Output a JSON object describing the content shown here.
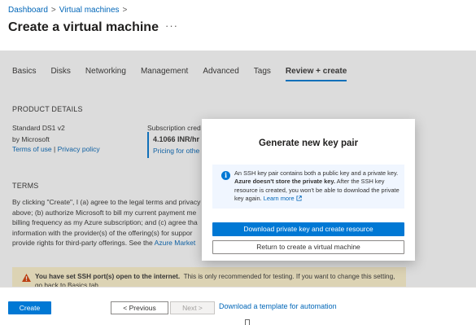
{
  "breadcrumb": {
    "items": [
      "Dashboard",
      "Virtual machines"
    ],
    "separator": ">"
  },
  "page": {
    "title": "Create a virtual machine",
    "more_label": "···"
  },
  "tabs": [
    {
      "label": "Basics",
      "active": false
    },
    {
      "label": "Disks",
      "active": false
    },
    {
      "label": "Networking",
      "active": false
    },
    {
      "label": "Management",
      "active": false
    },
    {
      "label": "Advanced",
      "active": false
    },
    {
      "label": "Tags",
      "active": false
    },
    {
      "label": "Review + create",
      "active": true
    }
  ],
  "product": {
    "heading": "PRODUCT DETAILS",
    "name": "Standard DS1 v2",
    "publisher": "by Microsoft",
    "terms_link": "Terms of use",
    "separator": "|",
    "privacy_link": "Privacy policy",
    "subscription_label": "Subscription cred",
    "price": "4.1066 INR/hr",
    "pricing_link": "Pricing for othe"
  },
  "terms": {
    "heading": "TERMS",
    "lines": [
      "By clicking \"Create\", I (a) agree to the legal terms and privacy",
      "above; (b) authorize Microsoft to bill my current payment me",
      "billing frequency as my Azure subscription; and (c) agree tha",
      "information with the provider(s) of the offering(s) for suppor",
      "provide rights for third-party offerings. See the"
    ],
    "marketplace_link": "Azure Market"
  },
  "warning": {
    "bold": "You have set SSH port(s) open to the internet.",
    "text": "This is only recommended for testing.  If you want to change this setting,",
    "line2": "go back to Basics tab."
  },
  "footer": {
    "create_label": "Create",
    "prev_label": "< Previous",
    "next_label": "Next >",
    "template_link": "Download a template for automation"
  },
  "modal": {
    "title": "Generate new key pair",
    "info_part1": "An SSH key pair contains both a public key and a private key.",
    "info_bold": "Azure doesn't store the private key.",
    "info_part2": "After the SSH key resource is created, you won't be able to download the private key again.",
    "learn_more": "Learn more",
    "primary_label": "Download private key and create resource",
    "secondary_label": "Return to create a virtual machine"
  },
  "colors": {
    "accent": "#0078d4",
    "warning_bg": "#fff4ce",
    "info_bg": "#f0f6ff"
  },
  "icons": [
    "more-icon",
    "warning-icon",
    "info-icon",
    "external-link-icon"
  ]
}
